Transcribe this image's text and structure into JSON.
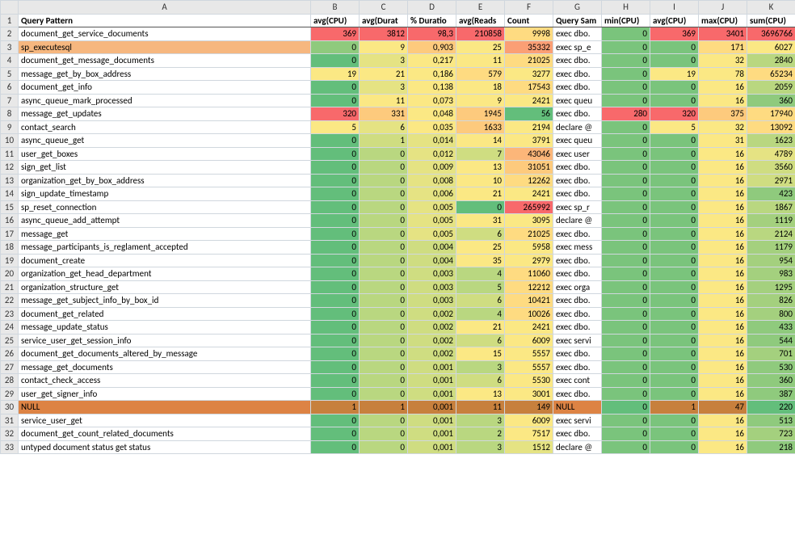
{
  "columns": [
    "A",
    "B",
    "C",
    "D",
    "E",
    "F",
    "G",
    "H",
    "I",
    "J",
    "K"
  ],
  "headers": [
    "Query Pattern",
    "avg(CPU)",
    "avg(Durat",
    "% Duratio",
    "avg(Reads",
    "Count",
    "Query Sam",
    "min(CPU)",
    "avg(CPU)",
    "max(CPU)",
    "sum(CPU)"
  ],
  "chart_data": {
    "type": "table",
    "title": "Query Pattern stats",
    "columns": [
      "Query Pattern",
      "avg(CPU)",
      "avg(Durat)",
      "% Duration",
      "avg(Reads)",
      "Count",
      "Query Sample",
      "min(CPU)",
      "avg(CPU)",
      "max(CPU)",
      "sum(CPU)"
    ]
  },
  "palette": {
    "hdr": "#ffffff",
    "g0": "#63be7b",
    "g1": "#7ac47c",
    "g2": "#8fca7d",
    "g3": "#a4d07e",
    "g4": "#b9d780",
    "g5": "#cfdd81",
    "y0": "#e5e383",
    "y1": "#fbe884",
    "y2": "#fedb81",
    "y3": "#fdca7d",
    "y4": "#fcb679",
    "y5": "#fb9f75",
    "r0": "#f98971",
    "r1": "#f8696b",
    "or": "#f6b77f",
    "ort": "#dd8344",
    "ord": "#c7803d"
  },
  "rows": [
    {
      "n": 2,
      "a": "document_get_service_documents",
      "ac": "hdr",
      "b": "369",
      "bc": "r1",
      "c": "3812",
      "cc": "r1",
      "d": "98,3",
      "dc": "r1",
      "e": "210858",
      "ec": "r1",
      "f": "9998",
      "fc": "y2",
      "g": "exec dbo.",
      "gc": "hdr",
      "h": "0",
      "hc": "g1",
      "i": "369",
      "ic": "r1",
      "j": "3401",
      "jc": "r1",
      "k": "3696766",
      "kc": "r1"
    },
    {
      "n": 3,
      "a": "sp_executesql",
      "ac": "or",
      "b": "0",
      "bc": "g2",
      "c": "9",
      "cc": "y1",
      "d": "0,903",
      "dc": "y3",
      "e": "25",
      "ec": "y1",
      "f": "35332",
      "fc": "y5",
      "g": "exec sp_e",
      "gc": "hdr",
      "h": "0",
      "hc": "g1",
      "i": "0",
      "ic": "g1",
      "j": "171",
      "jc": "y2",
      "k": "6027",
      "kc": "y1"
    },
    {
      "n": 4,
      "a": "document_get_message_documents",
      "ac": "hdr",
      "b": "0",
      "bc": "g0",
      "c": "3",
      "cc": "y0",
      "d": "0,217",
      "dc": "y1",
      "e": "11",
      "ec": "y1",
      "f": "21025",
      "fc": "y2",
      "g": "exec dbo.",
      "gc": "hdr",
      "h": "0",
      "hc": "g1",
      "i": "0",
      "ic": "g1",
      "j": "32",
      "jc": "y1",
      "k": "2840",
      "kc": "g4"
    },
    {
      "n": 5,
      "a": "message_get_by_box_address",
      "ac": "hdr",
      "b": "19",
      "bc": "y1",
      "c": "21",
      "cc": "y1",
      "d": "0,186",
      "dc": "y1",
      "e": "579",
      "ec": "y2",
      "f": "3277",
      "fc": "y1",
      "g": "exec dbo.",
      "gc": "hdr",
      "h": "0",
      "hc": "g1",
      "i": "19",
      "ic": "y1",
      "j": "78",
      "jc": "y1",
      "k": "65234",
      "kc": "y2"
    },
    {
      "n": 6,
      "a": "document_get_info",
      "ac": "hdr",
      "b": "0",
      "bc": "g0",
      "c": "3",
      "cc": "y0",
      "d": "0,138",
      "dc": "y1",
      "e": "18",
      "ec": "y1",
      "f": "17543",
      "fc": "y2",
      "g": "exec dbo.",
      "gc": "hdr",
      "h": "0",
      "hc": "g1",
      "i": "0",
      "ic": "g1",
      "j": "16",
      "jc": "y1",
      "k": "2059",
      "kc": "g4"
    },
    {
      "n": 7,
      "a": "async_queue_mark_processed",
      "ac": "hdr",
      "b": "0",
      "bc": "g0",
      "c": "11",
      "cc": "y1",
      "d": "0,073",
      "dc": "y1",
      "e": "9",
      "ec": "y1",
      "f": "2421",
      "fc": "y1",
      "g": "exec queu",
      "gc": "hdr",
      "h": "0",
      "hc": "g1",
      "i": "0",
      "ic": "g1",
      "j": "16",
      "jc": "y1",
      "k": "360",
      "kc": "g2"
    },
    {
      "n": 8,
      "a": "message_get_updates",
      "ac": "hdr",
      "b": "320",
      "bc": "r1",
      "c": "331",
      "cc": "y3",
      "d": "0,048",
      "dc": "y1",
      "e": "1945",
      "ec": "y3",
      "f": "56",
      "fc": "g0",
      "g": "exec dbo.",
      "gc": "hdr",
      "h": "280",
      "hc": "r1",
      "i": "320",
      "ic": "r1",
      "j": "375",
      "jc": "y3",
      "k": "17940",
      "kc": "y2"
    },
    {
      "n": 9,
      "a": "contact_search",
      "ac": "hdr",
      "b": "5",
      "bc": "y1",
      "c": "6",
      "cc": "y0",
      "d": "0,035",
      "dc": "y1",
      "e": "1633",
      "ec": "y3",
      "f": "2194",
      "fc": "y1",
      "g": "declare @",
      "gc": "hdr",
      "h": "0",
      "hc": "g1",
      "i": "5",
      "ic": "y1",
      "j": "32",
      "jc": "y1",
      "k": "13092",
      "kc": "y2"
    },
    {
      "n": 10,
      "a": "async_queue_get",
      "ac": "hdr",
      "b": "0",
      "bc": "g0",
      "c": "1",
      "cc": "g5",
      "d": "0,014",
      "dc": "y0",
      "e": "14",
      "ec": "y1",
      "f": "3791",
      "fc": "y1",
      "g": "exec queu",
      "gc": "hdr",
      "h": "0",
      "hc": "g1",
      "i": "0",
      "ic": "g1",
      "j": "31",
      "jc": "y1",
      "k": "1623",
      "kc": "g4"
    },
    {
      "n": 11,
      "a": "user_get_boxes",
      "ac": "hdr",
      "b": "0",
      "bc": "g0",
      "c": "0",
      "cc": "g4",
      "d": "0,012",
      "dc": "y0",
      "e": "7",
      "ec": "g5",
      "f": "43046",
      "fc": "y4",
      "g": "exec user",
      "gc": "hdr",
      "h": "0",
      "hc": "g1",
      "i": "0",
      "ic": "g1",
      "j": "16",
      "jc": "y1",
      "k": "4789",
      "kc": "y0"
    },
    {
      "n": 12,
      "a": "sign_get_list",
      "ac": "hdr",
      "b": "0",
      "bc": "g0",
      "c": "0",
      "cc": "g4",
      "d": "0,009",
      "dc": "y0",
      "e": "13",
      "ec": "y1",
      "f": "31051",
      "fc": "y3",
      "g": "exec dbo.",
      "gc": "hdr",
      "h": "0",
      "hc": "g1",
      "i": "0",
      "ic": "g1",
      "j": "16",
      "jc": "y1",
      "k": "3560",
      "kc": "g5"
    },
    {
      "n": 13,
      "a": "organization_get_by_box_address",
      "ac": "hdr",
      "b": "0",
      "bc": "g0",
      "c": "0",
      "cc": "g4",
      "d": "0,008",
      "dc": "y0",
      "e": "10",
      "ec": "y1",
      "f": "12262",
      "fc": "y2",
      "g": "exec dbo.",
      "gc": "hdr",
      "h": "0",
      "hc": "g1",
      "i": "0",
      "ic": "g1",
      "j": "16",
      "jc": "y1",
      "k": "2971",
      "kc": "g5"
    },
    {
      "n": 14,
      "a": "sign_update_timestamp",
      "ac": "hdr",
      "b": "0",
      "bc": "g0",
      "c": "0",
      "cc": "g4",
      "d": "0,006",
      "dc": "y0",
      "e": "21",
      "ec": "y1",
      "f": "2421",
      "fc": "y1",
      "g": "exec dbo.",
      "gc": "hdr",
      "h": "0",
      "hc": "g1",
      "i": "0",
      "ic": "g1",
      "j": "16",
      "jc": "y1",
      "k": "423",
      "kc": "g2"
    },
    {
      "n": 15,
      "a": "sp_reset_connection",
      "ac": "hdr",
      "b": "0",
      "bc": "g0",
      "c": "0",
      "cc": "g4",
      "d": "0,005",
      "dc": "y0",
      "e": "0",
      "ec": "g0",
      "f": "265992",
      "fc": "r1",
      "g": "exec sp_r",
      "gc": "hdr",
      "h": "0",
      "hc": "g1",
      "i": "0",
      "ic": "g1",
      "j": "16",
      "jc": "y1",
      "k": "1867",
      "kc": "g4"
    },
    {
      "n": 16,
      "a": "async_queue_add_attempt",
      "ac": "hdr",
      "b": "0",
      "bc": "g0",
      "c": "0",
      "cc": "g4",
      "d": "0,005",
      "dc": "y0",
      "e": "31",
      "ec": "y1",
      "f": "3095",
      "fc": "y1",
      "g": "declare @",
      "gc": "hdr",
      "h": "0",
      "hc": "g1",
      "i": "0",
      "ic": "g1",
      "j": "16",
      "jc": "y1",
      "k": "1119",
      "kc": "g3"
    },
    {
      "n": 17,
      "a": "message_get",
      "ac": "hdr",
      "b": "0",
      "bc": "g0",
      "c": "0",
      "cc": "g4",
      "d": "0,005",
      "dc": "y0",
      "e": "6",
      "ec": "g5",
      "f": "21025",
      "fc": "y2",
      "g": "exec dbo.",
      "gc": "hdr",
      "h": "0",
      "hc": "g1",
      "i": "0",
      "ic": "g1",
      "j": "16",
      "jc": "y1",
      "k": "2124",
      "kc": "g4"
    },
    {
      "n": 18,
      "a": "message_participants_is_reglament_accepted",
      "ac": "hdr",
      "b": "0",
      "bc": "g0",
      "c": "0",
      "cc": "g4",
      "d": "0,004",
      "dc": "g5",
      "e": "25",
      "ec": "y1",
      "f": "5958",
      "fc": "y1",
      "g": "exec mess",
      "gc": "hdr",
      "h": "0",
      "hc": "g1",
      "i": "0",
      "ic": "g1",
      "j": "16",
      "jc": "y1",
      "k": "1179",
      "kc": "g3"
    },
    {
      "n": 19,
      "a": "document_create",
      "ac": "hdr",
      "b": "0",
      "bc": "g0",
      "c": "0",
      "cc": "g4",
      "d": "0,004",
      "dc": "g5",
      "e": "35",
      "ec": "y1",
      "f": "2979",
      "fc": "y1",
      "g": "exec dbo.",
      "gc": "hdr",
      "h": "0",
      "hc": "g1",
      "i": "0",
      "ic": "g1",
      "j": "16",
      "jc": "y1",
      "k": "954",
      "kc": "g3"
    },
    {
      "n": 20,
      "a": "organization_get_head_department",
      "ac": "hdr",
      "b": "0",
      "bc": "g0",
      "c": "0",
      "cc": "g4",
      "d": "0,003",
      "dc": "g5",
      "e": "4",
      "ec": "g4",
      "f": "11060",
      "fc": "y2",
      "g": "exec dbo.",
      "gc": "hdr",
      "h": "0",
      "hc": "g1",
      "i": "0",
      "ic": "g1",
      "j": "16",
      "jc": "y1",
      "k": "983",
      "kc": "g3"
    },
    {
      "n": 21,
      "a": "organization_structure_get",
      "ac": "hdr",
      "b": "0",
      "bc": "g0",
      "c": "0",
      "cc": "g4",
      "d": "0,003",
      "dc": "g5",
      "e": "5",
      "ec": "g4",
      "f": "12212",
      "fc": "y2",
      "g": "exec orga",
      "gc": "hdr",
      "h": "0",
      "hc": "g1",
      "i": "0",
      "ic": "g1",
      "j": "16",
      "jc": "y1",
      "k": "1295",
      "kc": "g3"
    },
    {
      "n": 22,
      "a": "message_get_subject_info_by_box_id",
      "ac": "hdr",
      "b": "0",
      "bc": "g0",
      "c": "0",
      "cc": "g4",
      "d": "0,003",
      "dc": "g5",
      "e": "6",
      "ec": "g5",
      "f": "10421",
      "fc": "y2",
      "g": "exec dbo.",
      "gc": "hdr",
      "h": "0",
      "hc": "g1",
      "i": "0",
      "ic": "g1",
      "j": "16",
      "jc": "y1",
      "k": "826",
      "kc": "g3"
    },
    {
      "n": 23,
      "a": "document_get_related",
      "ac": "hdr",
      "b": "0",
      "bc": "g0",
      "c": "0",
      "cc": "g4",
      "d": "0,002",
      "dc": "g5",
      "e": "4",
      "ec": "g4",
      "f": "10026",
      "fc": "y2",
      "g": "exec dbo.",
      "gc": "hdr",
      "h": "0",
      "hc": "g1",
      "i": "0",
      "ic": "g1",
      "j": "16",
      "jc": "y1",
      "k": "800",
      "kc": "g3"
    },
    {
      "n": 24,
      "a": "message_update_status",
      "ac": "hdr",
      "b": "0",
      "bc": "g0",
      "c": "0",
      "cc": "g4",
      "d": "0,002",
      "dc": "g5",
      "e": "21",
      "ec": "y1",
      "f": "2421",
      "fc": "y1",
      "g": "exec dbo.",
      "gc": "hdr",
      "h": "0",
      "hc": "g1",
      "i": "0",
      "ic": "g1",
      "j": "16",
      "jc": "y1",
      "k": "433",
      "kc": "g2"
    },
    {
      "n": 25,
      "a": "service_user_get_session_info",
      "ac": "hdr",
      "b": "0",
      "bc": "g0",
      "c": "0",
      "cc": "g4",
      "d": "0,002",
      "dc": "g5",
      "e": "6",
      "ec": "g5",
      "f": "6009",
      "fc": "y1",
      "g": "exec servi",
      "gc": "hdr",
      "h": "0",
      "hc": "g1",
      "i": "0",
      "ic": "g1",
      "j": "16",
      "jc": "y1",
      "k": "544",
      "kc": "g2"
    },
    {
      "n": 26,
      "a": "document_get_documents_altered_by_message",
      "ac": "hdr",
      "b": "0",
      "bc": "g0",
      "c": "0",
      "cc": "g4",
      "d": "0,002",
      "dc": "g5",
      "e": "15",
      "ec": "y1",
      "f": "5557",
      "fc": "y1",
      "g": "exec dbo.",
      "gc": "hdr",
      "h": "0",
      "hc": "g1",
      "i": "0",
      "ic": "g1",
      "j": "16",
      "jc": "y1",
      "k": "701",
      "kc": "g3"
    },
    {
      "n": 27,
      "a": "message_get_documents",
      "ac": "hdr",
      "b": "0",
      "bc": "g0",
      "c": "0",
      "cc": "g4",
      "d": "0,001",
      "dc": "g5",
      "e": "3",
      "ec": "g4",
      "f": "5557",
      "fc": "y1",
      "g": "exec dbo.",
      "gc": "hdr",
      "h": "0",
      "hc": "g1",
      "i": "0",
      "ic": "g1",
      "j": "16",
      "jc": "y1",
      "k": "530",
      "kc": "g2"
    },
    {
      "n": 28,
      "a": "contact_check_access",
      "ac": "hdr",
      "b": "0",
      "bc": "g0",
      "c": "0",
      "cc": "g4",
      "d": "0,001",
      "dc": "g5",
      "e": "6",
      "ec": "g5",
      "f": "5530",
      "fc": "y1",
      "g": "exec cont",
      "gc": "hdr",
      "h": "0",
      "hc": "g1",
      "i": "0",
      "ic": "g1",
      "j": "16",
      "jc": "y1",
      "k": "360",
      "kc": "g2"
    },
    {
      "n": 29,
      "a": "user_get_signer_info",
      "ac": "hdr",
      "b": "0",
      "bc": "g0",
      "c": "0",
      "cc": "g4",
      "d": "0,001",
      "dc": "g5",
      "e": "13",
      "ec": "y1",
      "f": "3001",
      "fc": "y1",
      "g": "exec dbo.",
      "gc": "hdr",
      "h": "0",
      "hc": "g1",
      "i": "0",
      "ic": "g1",
      "j": "16",
      "jc": "y1",
      "k": "387",
      "kc": "g2"
    },
    {
      "n": 30,
      "a": "NULL",
      "ac": "ort",
      "b": "1",
      "bc": "ord",
      "c": "1",
      "cc": "ord",
      "d": "0,001",
      "dc": "ord",
      "e": "11",
      "ec": "ord",
      "f": "149",
      "fc": "ord",
      "g": "NULL",
      "gc": "ort",
      "h": "0",
      "hc": "g0",
      "i": "1",
      "ic": "ord",
      "j": "47",
      "jc": "ord",
      "k": "220",
      "kc": "g0"
    },
    {
      "n": 31,
      "a": "service_user_get",
      "ac": "hdr",
      "b": "0",
      "bc": "g0",
      "c": "0",
      "cc": "g4",
      "d": "0,001",
      "dc": "g5",
      "e": "3",
      "ec": "g4",
      "f": "6009",
      "fc": "y1",
      "g": "exec servi",
      "gc": "hdr",
      "h": "0",
      "hc": "g1",
      "i": "0",
      "ic": "g1",
      "j": "16",
      "jc": "y1",
      "k": "513",
      "kc": "g2"
    },
    {
      "n": 32,
      "a": "document_get_count_related_documents",
      "ac": "hdr",
      "b": "0",
      "bc": "g0",
      "c": "0",
      "cc": "g4",
      "d": "0,001",
      "dc": "g5",
      "e": "2",
      "ec": "g4",
      "f": "7517",
      "fc": "y1",
      "g": "exec dbo.",
      "gc": "hdr",
      "h": "0",
      "hc": "g1",
      "i": "0",
      "ic": "g1",
      "j": "16",
      "jc": "y1",
      "k": "723",
      "kc": "g3"
    },
    {
      "n": 33,
      "a": "untyped document status get status",
      "ac": "hdr",
      "b": "0",
      "bc": "g0",
      "c": "0",
      "cc": "g4",
      "d": "0,001",
      "dc": "g5",
      "e": "3",
      "ec": "g4",
      "f": "1512",
      "fc": "y0",
      "g": "declare @",
      "gc": "hdr",
      "h": "0",
      "hc": "g1",
      "i": "0",
      "ic": "g1",
      "j": "16",
      "jc": "y1",
      "k": "218",
      "kc": "g2"
    }
  ]
}
